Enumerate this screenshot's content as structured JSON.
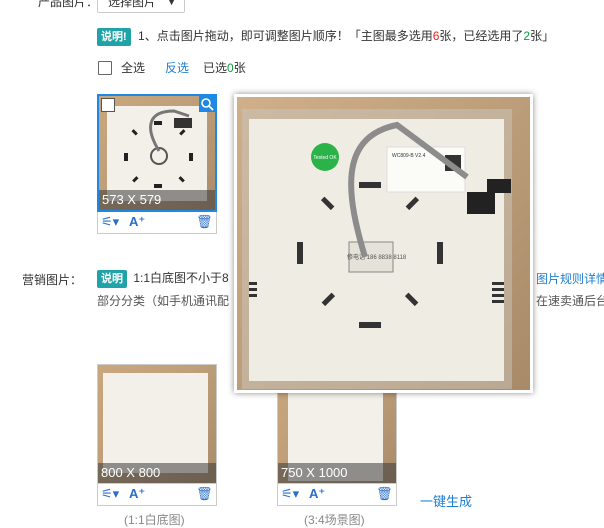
{
  "product_images": {
    "label": "产品图片：",
    "select_button": "选择图片"
  },
  "tip": {
    "badge": "说明!",
    "text_before": "1、点击图片拖动，即可调整图片顺序！「主图最多选用",
    "max_count": "6",
    "text_middle": "张，已经选用了",
    "used_count": "2",
    "text_after": "张」"
  },
  "selection": {
    "select_all": "全选",
    "invert": "反选",
    "selected_prefix": "已选",
    "selected_count": "0",
    "selected_suffix": "张"
  },
  "main_thumb": {
    "dimensions": "573 X 579"
  },
  "preview_overlay": {
    "sticker_text": "Tested OK",
    "label_text": "WC809-B V2.4",
    "phone_text": "修电话 186 8838 8118"
  },
  "marketing": {
    "label": "营销图片：",
    "badge": "说明",
    "text_line1": "1:1白底图不小于8",
    "rule_link": "图片规则详情",
    "text_line2": "部分分类（如手机通讯配",
    "text_line2_tail": "在速卖通后台",
    "items": [
      {
        "dimensions": "800 X 800",
        "caption": "(1:1白底图)"
      },
      {
        "dimensions": "750 X 1000",
        "caption": "(3:4场景图)"
      }
    ],
    "one_click": "一键生成"
  },
  "icons": {
    "wand": "magic-wand-icon",
    "ai": "ai-text-icon",
    "trash": "trash-icon",
    "zoom": "zoom-icon"
  },
  "colors": {
    "accent": "#1fa3a8",
    "link": "#1e7fd1",
    "red": "#e1251b",
    "green": "#0a9c3b"
  }
}
